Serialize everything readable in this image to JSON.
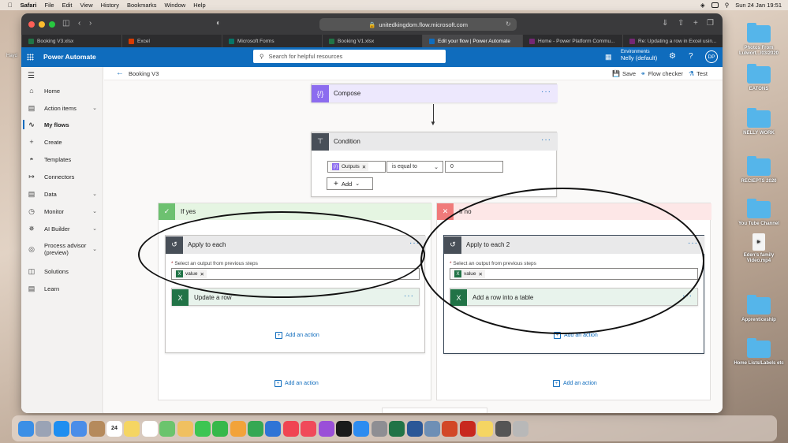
{
  "menubar": {
    "items": [
      "Safari",
      "File",
      "Edit",
      "View",
      "History",
      "Bookmarks",
      "Window",
      "Help"
    ],
    "clock": "Sun 24 Jan  19:51"
  },
  "browser": {
    "url": "unitedkingdom.flow.microsoft.com",
    "tabs": [
      {
        "label": "Booking V3.xlsx",
        "color": "#217346"
      },
      {
        "label": "Excel",
        "color": "#d83b01"
      },
      {
        "label": "Microsoft Forms",
        "color": "#077568"
      },
      {
        "label": "Booking V1.xlsx",
        "color": "#217346"
      },
      {
        "label": "Edit your flow | Power Automate",
        "color": "#0f6cbd"
      },
      {
        "label": "Home - Power Platform Commu...",
        "color": "#742774"
      },
      {
        "label": "Re: Updating a row in Excel usin...",
        "color": "#742774"
      }
    ]
  },
  "header": {
    "app_name": "Power Automate",
    "search_placeholder": "Search for helpful resources",
    "env_label": "Environments",
    "env_value": "Nelly (default)",
    "avatar": "DP"
  },
  "sidebar": {
    "items": [
      {
        "label": "Home",
        "icon": "home-icon"
      },
      {
        "label": "Action items",
        "icon": "clipboard-icon",
        "chevron": true
      },
      {
        "label": "My flows",
        "icon": "flow-icon",
        "active": true
      },
      {
        "label": "Create",
        "icon": "plus-icon"
      },
      {
        "label": "Templates",
        "icon": "template-icon"
      },
      {
        "label": "Connectors",
        "icon": "connector-icon"
      },
      {
        "label": "Data",
        "icon": "database-icon",
        "chevron": true
      },
      {
        "label": "Monitor",
        "icon": "monitor-icon",
        "chevron": true
      },
      {
        "label": "AI Builder",
        "icon": "ai-icon",
        "chevron": true
      },
      {
        "label": "Process advisor (preview)",
        "icon": "process-icon",
        "chevron": true
      },
      {
        "label": "Solutions",
        "icon": "solutions-icon"
      },
      {
        "label": "Learn",
        "icon": "book-icon"
      }
    ]
  },
  "cmdbar": {
    "flow_name": "Booking V3",
    "save": "Save",
    "checker": "Flow checker",
    "test": "Test"
  },
  "flow": {
    "compose": {
      "title": "Compose",
      "color": "#8c6cef"
    },
    "condition": {
      "title": "Condition",
      "token": "Outputs",
      "operator": "is equal to",
      "value": "0",
      "add": "Add"
    },
    "if_yes": {
      "label": "If yes",
      "apply": "Apply to each",
      "select_label": "Select an output from previous steps",
      "token": "value",
      "action": "Update a row",
      "add_inner": "Add an action",
      "add_outer": "Add an action"
    },
    "if_no": {
      "label": "If no",
      "apply": "Apply to each 2",
      "select_label": "Select an output from previous steps",
      "token": "value",
      "action": "Add a row into a table",
      "add_inner": "Add an action",
      "add_outer": "Add an action"
    }
  },
  "desktop": {
    "left_text": "Hayd",
    "icons": [
      {
        "label": "Photos From Lulwort.../03/2020"
      },
      {
        "label": "EATONS"
      },
      {
        "label": "NELLY WORK"
      },
      {
        "label": "RECIEPTS 2020"
      },
      {
        "label": "You Tube Channel"
      },
      {
        "label": "Eden's family Video.mp4"
      },
      {
        "label": "Apprenticeship"
      },
      {
        "label": "Home Lists/Labels etc"
      }
    ]
  },
  "dock": {
    "calendar_day": "24",
    "apps": [
      {
        "name": "finder",
        "color": "#3b8fe6"
      },
      {
        "name": "launchpad",
        "color": "#9aa3b5"
      },
      {
        "name": "safari",
        "color": "#1e8ef0"
      },
      {
        "name": "mail",
        "color": "#4a8de8"
      },
      {
        "name": "contacts",
        "color": "#b58a5c"
      },
      {
        "name": "calendar",
        "color": "#ffffff"
      },
      {
        "name": "notes",
        "color": "#f5d562"
      },
      {
        "name": "reminders",
        "color": "#ffffff"
      },
      {
        "name": "maps",
        "color": "#6bc46d"
      },
      {
        "name": "photos",
        "color": "#f0c060"
      },
      {
        "name": "messages",
        "color": "#3cc552"
      },
      {
        "name": "facetime",
        "color": "#36b84a"
      },
      {
        "name": "pages",
        "color": "#f2a33a"
      },
      {
        "name": "numbers",
        "color": "#35a853"
      },
      {
        "name": "keynote",
        "color": "#2f74d6"
      },
      {
        "name": "news",
        "color": "#f04452"
      },
      {
        "name": "music",
        "color": "#f04a5a"
      },
      {
        "name": "podcasts",
        "color": "#9a4fd8"
      },
      {
        "name": "tv",
        "color": "#1a1a1a"
      },
      {
        "name": "app-store",
        "color": "#2d8cf0"
      },
      {
        "name": "settings",
        "color": "#8e8e93"
      },
      {
        "name": "excel",
        "color": "#217346"
      },
      {
        "name": "word",
        "color": "#2b5797"
      },
      {
        "name": "preview",
        "color": "#6e8fb5"
      },
      {
        "name": "powerpoint",
        "color": "#d24726"
      },
      {
        "name": "photo-booth",
        "color": "#c8281e"
      },
      {
        "name": "stickies",
        "color": "#f5d562"
      },
      {
        "name": "downloads",
        "color": "#555555"
      },
      {
        "name": "trash",
        "color": "#b8b8b8"
      }
    ]
  }
}
